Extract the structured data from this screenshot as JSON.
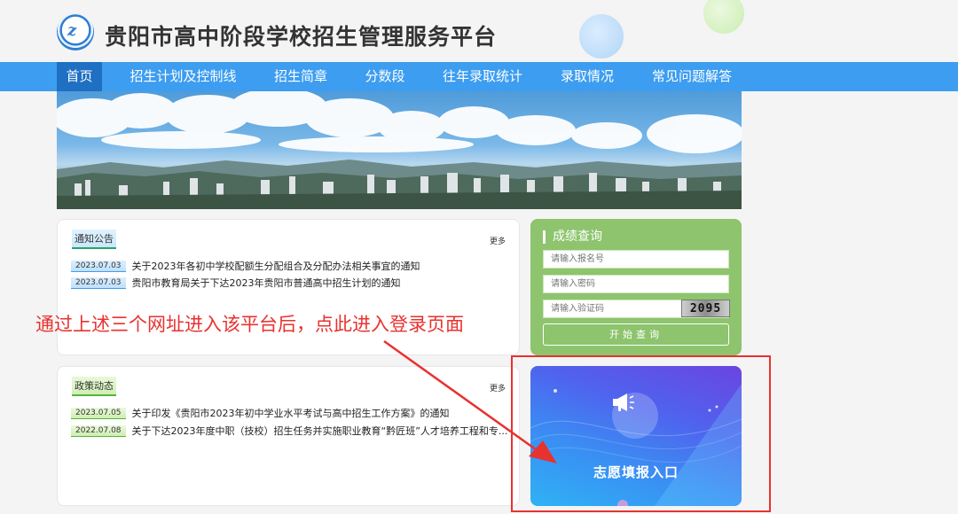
{
  "header": {
    "logo_mark": "z",
    "site_title": "贵阳市高中阶段学校招生管理服务平台"
  },
  "nav": {
    "items": [
      {
        "label": "首页",
        "active": true
      },
      {
        "label": "招生计划及控制线"
      },
      {
        "label": "招生简章"
      },
      {
        "label": "分数段"
      },
      {
        "label": "往年录取统计"
      },
      {
        "label": "录取情况"
      },
      {
        "label": "常见问题解答"
      }
    ]
  },
  "notice": {
    "tag": "通知公告",
    "more": "更多",
    "items": [
      {
        "date": "2023.07.03",
        "title": "关于2023年各初中学校配额生分配组合及分配办法相关事宜的通知"
      },
      {
        "date": "2023.07.03",
        "title": "贵阳市教育局关于下达2023年贵阳市普通高中招生计划的通知"
      }
    ]
  },
  "policy": {
    "tag": "政策动态",
    "more": "更多",
    "items": [
      {
        "date": "2023.07.05",
        "title": "关于印发《贵阳市2023年初中学业水平考试与高中招生工作方案》的通知"
      },
      {
        "date": "2022.07.08",
        "title": "关于下达2023年度中职（技校）招生任务并实施职业教育“黔匠班”人才培养工程和专..."
      }
    ]
  },
  "score_query": {
    "title": "成绩查询",
    "fields": {
      "registration_placeholder": "请输入报名号",
      "password_placeholder": "请输入密码",
      "captcha_placeholder": "请输入验证码"
    },
    "captcha_text": "2095",
    "submit_label": "开始查询"
  },
  "entrance": {
    "label": "志愿填报入口",
    "icon": "megaphone-icon"
  },
  "annotation": {
    "text": "通过上述三个网址进入该平台后，点此进入登录页面",
    "color": "#e8322f"
  },
  "colors": {
    "nav_bg": "#3d9df0",
    "nav_active": "#1f6fc3",
    "query_bg": "#8dc46d"
  }
}
